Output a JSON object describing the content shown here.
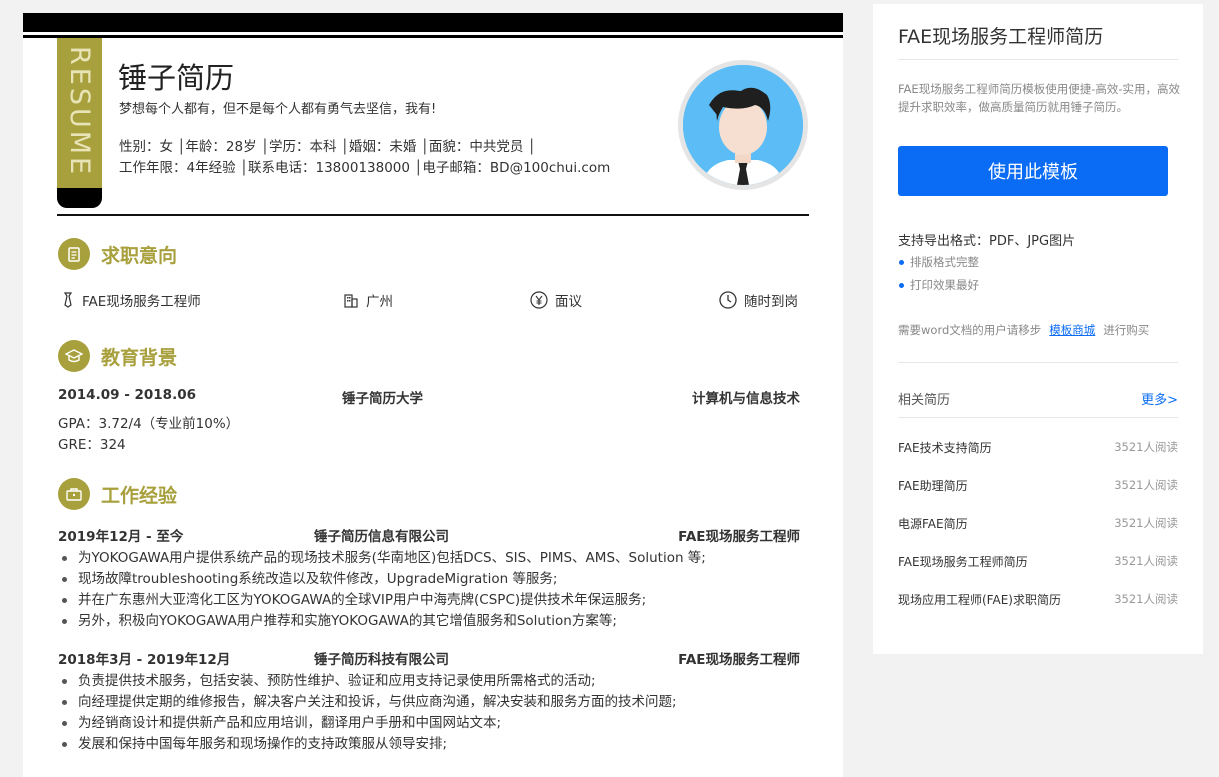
{
  "resume": {
    "tab_text": "RESUME",
    "name": "锤子简历",
    "motto": "梦想每个人都有，但不是每个人都有勇气去坚信，我有!",
    "info_line1": "性别：女 │年龄：28岁 │学历：本科 │婚姻：未婚 │面貌：中共党员 │",
    "info_line2": "工作年限：4年经验 │联系电话：13800138000 │电子邮箱：BD@100chui.com"
  },
  "sections": {
    "intent_title": "求职意向",
    "education_title": "教育背景",
    "work_title": "工作经验"
  },
  "intent": {
    "position": "FAE现场服务工程师",
    "city": "广州",
    "salary": "面议",
    "availability": "随时到岗"
  },
  "education": {
    "period": "2014.09 - 2018.06",
    "school": "锤子简历大学",
    "major": "计算机与信息技术",
    "gpa": "GPA：3.72/4（专业前10%）",
    "gre": "GRE：324"
  },
  "work": [
    {
      "period": "2019年12月 - 至今",
      "company": "锤子简历信息有限公司",
      "title": "FAE现场服务工程师",
      "bullets": [
        "为YOKOGAWA用户提供系统产品的现场技术服务(华南地区)包括DCS、SIS、PIMS、AMS、Solution 等;",
        "现场故障troubleshooting系统改造以及软件修改，UpgradeMigration 等服务;",
        "并在广东惠州大亚湾化工区为YOKOGAWA的全球VIP用户中海壳牌(CSPC)提供技术年保运服务;",
        "另外，积极向YOKOGAWA用户推荐和实施YOKOGAWA的其它增值服务和Solution方案等;"
      ]
    },
    {
      "period": "2018年3月 - 2019年12月",
      "company": "锤子简历科技有限公司",
      "title": "FAE现场服务工程师",
      "bullets": [
        "负责提供技术服务，包括安装、预防性维护、验证和应用支持记录使用所需格式的活动;",
        "向经理提供定期的维修报告，解决客户关注和投诉，与供应商沟通，解决安装和服务方面的技术问题;",
        "为经销商设计和提供新产品和应用培训，翻译用户手册和中国网站文本;",
        "发展和保持中国每年服务和现场操作的支持政策服从领导安排;"
      ]
    }
  ],
  "panel": {
    "title": "FAE现场服务工程师简历",
    "description": "FAE现场服务工程师简历模板使用便捷-高效-实用，高效提升求职效率，做高质量简历就用锤子简历。",
    "use_button": "使用此模板",
    "export_formats": "支持导出格式：PDF、JPG图片",
    "features": [
      "排版格式完整",
      "打印效果最好"
    ],
    "word_prefix": "需要word文档的用户请移步",
    "word_link": "模板商城",
    "word_suffix": "进行购买",
    "related_title": "相关简历",
    "more_link": "更多>",
    "related": [
      {
        "title": "FAE技术支持简历",
        "reads": "3521人阅读"
      },
      {
        "title": "FAE助理简历",
        "reads": "3521人阅读"
      },
      {
        "title": "电源FAE简历",
        "reads": "3521人阅读"
      },
      {
        "title": "FAE现场服务工程师简历",
        "reads": "3521人阅读"
      },
      {
        "title": "现场应用工程师(FAE)求职简历",
        "reads": "3521人阅读"
      }
    ]
  },
  "colors": {
    "accent": "#a8a03c",
    "button": "#0a6cf5",
    "avatar_bg": "#5bbcf6"
  }
}
